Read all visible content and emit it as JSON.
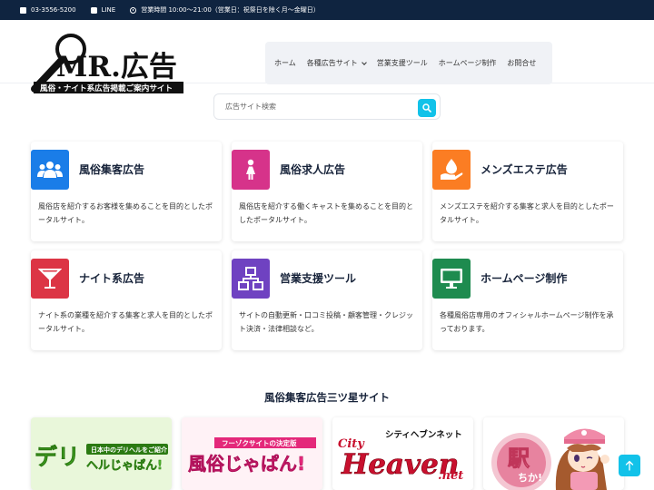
{
  "topbar": {
    "phone": "03-3556-5200",
    "line": "LINE",
    "hours": "営業時間 10:00〜21:00（営業日：祝祭日を除く月〜金曜日）"
  },
  "logo": {
    "name": "MR.広告",
    "tagline": "風俗・ナイト系広告掲載ご案内サイト"
  },
  "nav": {
    "items": [
      "ホーム",
      "各種広告サイト",
      "営業支援ツール",
      "ホームページ制作",
      "お問合せ"
    ]
  },
  "search": {
    "placeholder": "広告サイト検索"
  },
  "cards": [
    {
      "title": "風俗集客広告",
      "desc": "風俗店を紹介するお客様を集めることを目的としたポータルサイト。",
      "color": "#1a7de8",
      "icon": "users-icon"
    },
    {
      "title": "風俗求人広告",
      "desc": "風俗店を紹介する働くキャストを集めることを目的としたポータルサイト。",
      "color": "#d6338a",
      "icon": "female-icon"
    },
    {
      "title": "メンズエステ広告",
      "desc": "メンズエステを紹介する集客と求人を目的としたポータルサイト。",
      "color": "#fb7d23",
      "icon": "spa-icon"
    },
    {
      "title": "ナイト系広告",
      "desc": "ナイト系の業種を紹介する集客と求人を目的としたポータルサイト。",
      "color": "#dc3545",
      "icon": "cocktail-icon"
    },
    {
      "title": "営業支援ツール",
      "desc": "サイトの自動更新・口コミ投稿・顧客管理・クレジット決済・法律相談など。",
      "color": "#6f42c1",
      "icon": "network-icon"
    },
    {
      "title": "ホームページ制作",
      "desc": "各種風俗店専用のオフィシャルホームページ制作を承っております。",
      "color": "#1e8b4f",
      "icon": "monitor-icon"
    }
  ],
  "section": {
    "title": "風俗集客広告三ツ星サイト"
  },
  "banners": {
    "deli": {
      "main1": "デリ",
      "main2": "ヘルじゃぱん!",
      "sub": "日本中のデリヘルをご紹介"
    },
    "fuzoku": {
      "main": "風俗じゃぱん!",
      "sub": "フーゾクサイトの決定版"
    },
    "heaven": {
      "top": "シティヘブンネット",
      "city": "City",
      "main": "Heaven",
      "net": ".net"
    },
    "eki": {
      "main": "駅",
      "sub": "ちか!"
    }
  },
  "colors": {
    "topbar": "#0f2440",
    "accent": "#12c2e9"
  }
}
